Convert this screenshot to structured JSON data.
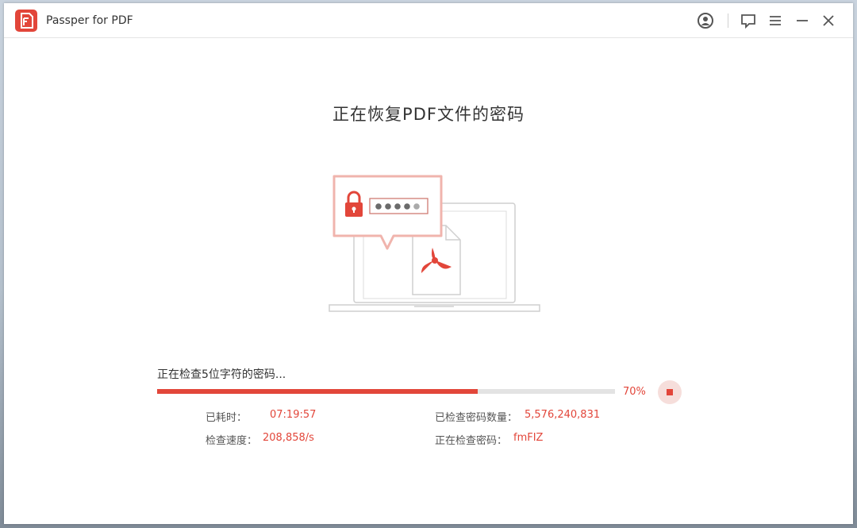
{
  "app": {
    "title": "Passper for PDF",
    "logo_icon": "passper-logo"
  },
  "titlebar": {
    "icons": [
      "user-icon",
      "feedback-icon",
      "menu-icon",
      "minimize-icon",
      "close-icon"
    ]
  },
  "main": {
    "heading": "正在恢复PDF文件的密码"
  },
  "progress": {
    "status": "正在检查5位字符的密码...",
    "percent_label": "70%",
    "percent_value": 0.7
  },
  "stats": {
    "elapsed_label": "已耗时：",
    "elapsed_value": "07:19:57",
    "speed_label": "检查速度：",
    "speed_value": "208,858/s",
    "checked_label": "已检查密码数量：",
    "checked_value": "5,576,240,831",
    "current_label": "正在检查密码：",
    "current_value": "fmFIZ"
  },
  "colors": {
    "accent": "#e2463a",
    "accent_light": "#f6dedb"
  }
}
